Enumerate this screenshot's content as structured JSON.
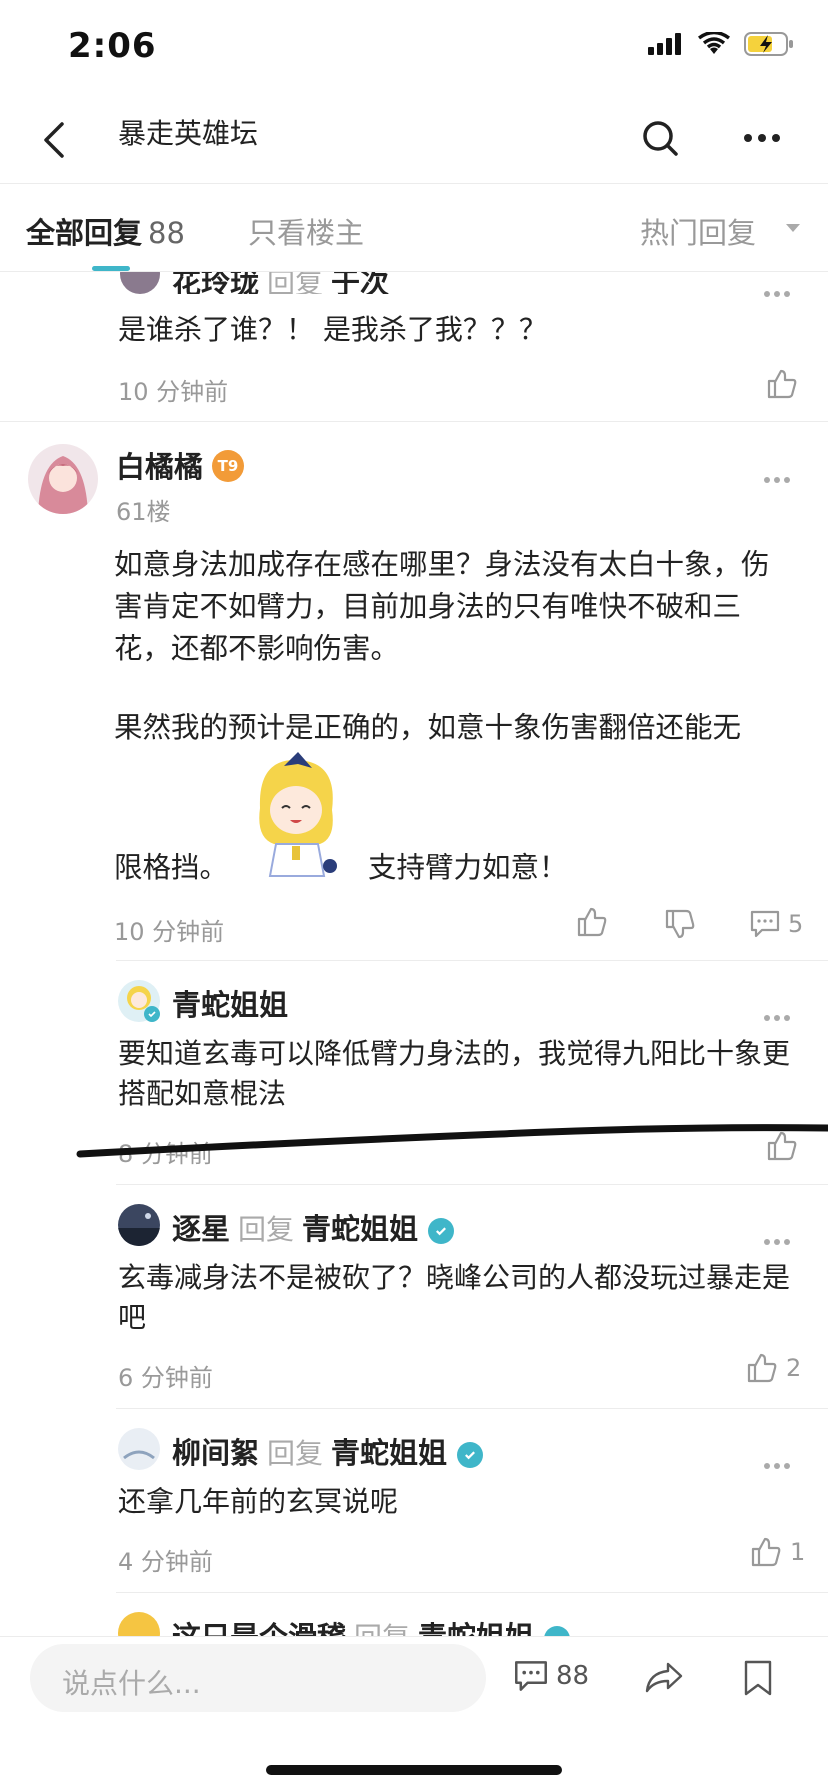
{
  "status": {
    "time": "2:06"
  },
  "nav": {
    "title": "暴走英雄坛"
  },
  "tabs": {
    "all_label": "全部回复",
    "all_count": "88",
    "op_only": "只看楼主",
    "sort": "热门回复"
  },
  "top_reply": {
    "user": "花玲珑",
    "reply_word": "回复",
    "target": "于次",
    "text": "是谁杀了谁？！ 是我杀了我？？？",
    "time": "10 分钟前"
  },
  "post": {
    "user": "白橘橘",
    "badge": "T9",
    "floor": "61楼",
    "para1": "如意身法加成存在感在哪里？身法没有太白十象，伤害肯定不如臂力，目前加身法的只有唯快不破和三花，还都不影响伤害。",
    "para2a": "果然我的预计是正确的，如意十象伤害翻倍还能无",
    "para2b": "限格挡。",
    "para2c": "支持臂力如意！",
    "time": "10 分钟前",
    "comment_count": "5"
  },
  "replies": [
    {
      "user": "青蛇姐姐",
      "text": "要知道玄毒可以降低臂力身法的，我觉得九阳比十象更搭配如意棍法",
      "time": "8 分钟前",
      "likes": ""
    },
    {
      "user": "逐星",
      "reply_word": "回复",
      "target": "青蛇姐姐",
      "text": "玄毒减身法不是被砍了？晓峰公司的人都没玩过暴走是吧",
      "time": "6 分钟前",
      "likes": "2"
    },
    {
      "user": "柳间絮",
      "reply_word": "回复",
      "target": "青蛇姐姐",
      "text": "还拿几年前的玄冥说呢",
      "time": "4 分钟前",
      "likes": "1"
    },
    {
      "user": "这只是个滑稽",
      "reply_word": "回复",
      "target": "青蛇姐姐"
    }
  ],
  "bottom": {
    "placeholder": "说点什么...",
    "comment_count": "88"
  }
}
